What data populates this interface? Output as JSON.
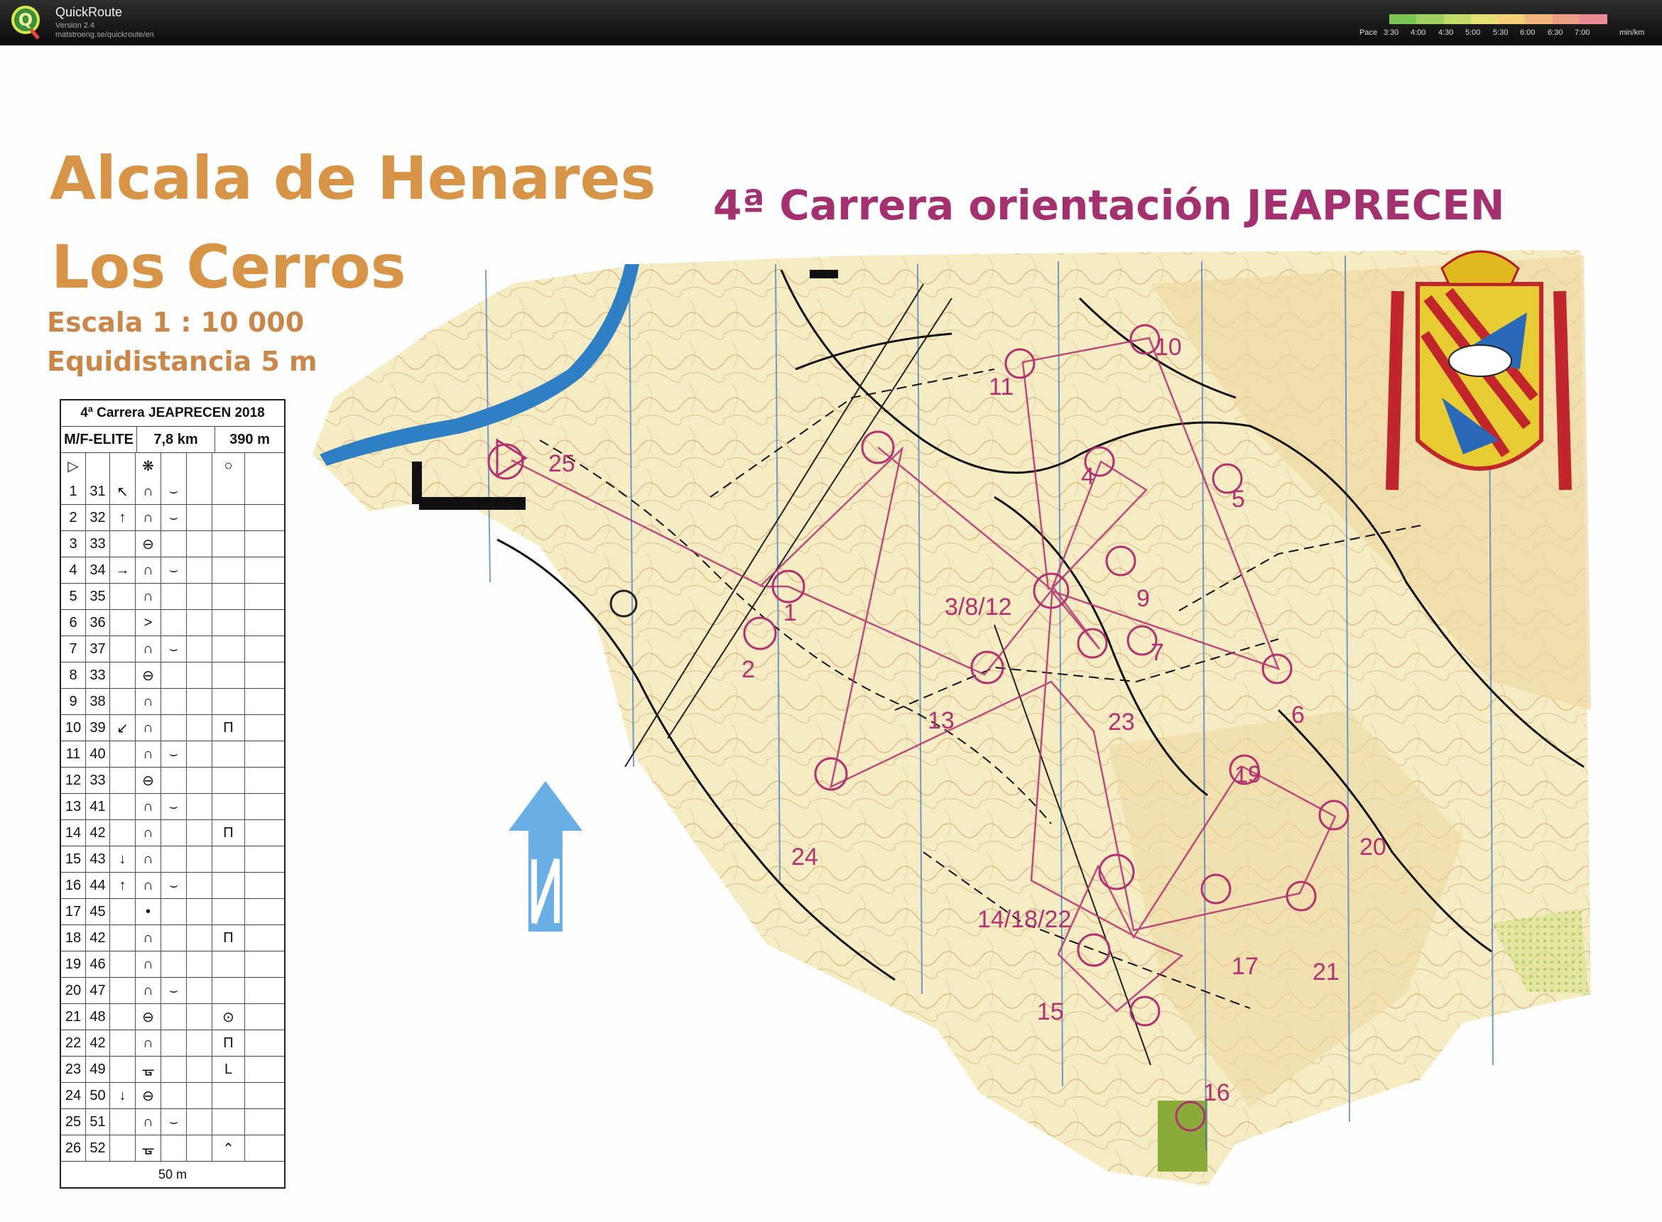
{
  "app": {
    "name": "QuickRoute",
    "version": "Version 2.4",
    "url": "matstroeng.se/quickroute/en"
  },
  "pace_legend": {
    "label": "Pace",
    "ticks": [
      "3:30",
      "4:00",
      "4:30",
      "5:00",
      "5:30",
      "6:00",
      "6:30",
      "7:00"
    ],
    "unit": "min/km",
    "colors": [
      "#7cc454",
      "#9fd061",
      "#c4da6b",
      "#e4e074",
      "#f3cf77",
      "#f2b57c",
      "#ef9d86",
      "#ea8a92"
    ]
  },
  "map": {
    "title_line1": "Alcala de Henares",
    "title_line2": "Los Cerros",
    "scale": "Escala   1 : 10 000",
    "equidistance": "Equidistancia 5 m",
    "event_title": "4ª Carrera orientación JEAPRECEN",
    "colors": {
      "course": "#b2316f",
      "paper": "#f7eec2",
      "water": "#2f7fc4",
      "north_arrow": "#6aaee6"
    }
  },
  "legend": {
    "header": "4ª Carrera JEAPRECEN 2018",
    "category": "M/F-ELITE",
    "length": "7,8 km",
    "climb": "390 m",
    "controls": [
      {
        "n": "1",
        "code": "31",
        "dir": "↖",
        "feat": "∩",
        "det": "⌣",
        "extra": ""
      },
      {
        "n": "2",
        "code": "32",
        "dir": "↑",
        "feat": "∩",
        "det": "⌣",
        "extra": ""
      },
      {
        "n": "3",
        "code": "33",
        "dir": "",
        "feat": "⊖",
        "det": "",
        "extra": ""
      },
      {
        "n": "4",
        "code": "34",
        "dir": "→",
        "feat": "∩",
        "det": "⌣",
        "extra": ""
      },
      {
        "n": "5",
        "code": "35",
        "dir": "",
        "feat": "∩",
        "det": "",
        "extra": ""
      },
      {
        "n": "6",
        "code": "36",
        "dir": "",
        "feat": ">",
        "det": "",
        "extra": ""
      },
      {
        "n": "7",
        "code": "37",
        "dir": "",
        "feat": "∩",
        "det": "⌣",
        "extra": ""
      },
      {
        "n": "8",
        "code": "33",
        "dir": "",
        "feat": "⊖",
        "det": "",
        "extra": ""
      },
      {
        "n": "9",
        "code": "38",
        "dir": "",
        "feat": "∩",
        "det": "",
        "extra": ""
      },
      {
        "n": "10",
        "code": "39",
        "dir": "↙",
        "feat": "∩",
        "det": "",
        "extra": "Π"
      },
      {
        "n": "11",
        "code": "40",
        "dir": "",
        "feat": "∩",
        "det": "⌣",
        "extra": ""
      },
      {
        "n": "12",
        "code": "33",
        "dir": "",
        "feat": "⊖",
        "det": "",
        "extra": ""
      },
      {
        "n": "13",
        "code": "41",
        "dir": "",
        "feat": "∩",
        "det": "⌣",
        "extra": ""
      },
      {
        "n": "14",
        "code": "42",
        "dir": "",
        "feat": "∩",
        "det": "",
        "extra": "Π"
      },
      {
        "n": "15",
        "code": "43",
        "dir": "↓",
        "feat": "∩",
        "det": "",
        "extra": ""
      },
      {
        "n": "16",
        "code": "44",
        "dir": "↑",
        "feat": "∩",
        "det": "⌣",
        "extra": ""
      },
      {
        "n": "17",
        "code": "45",
        "dir": "",
        "feat": "•",
        "det": "",
        "extra": ""
      },
      {
        "n": "18",
        "code": "42",
        "dir": "",
        "feat": "∩",
        "det": "",
        "extra": "Π"
      },
      {
        "n": "19",
        "code": "46",
        "dir": "",
        "feat": "∩",
        "det": "",
        "extra": ""
      },
      {
        "n": "20",
        "code": "47",
        "dir": "",
        "feat": "∩",
        "det": "⌣",
        "extra": ""
      },
      {
        "n": "21",
        "code": "48",
        "dir": "",
        "feat": "⊖",
        "det": "",
        "extra": "⊙"
      },
      {
        "n": "22",
        "code": "42",
        "dir": "",
        "feat": "∩",
        "det": "",
        "extra": "Π"
      },
      {
        "n": "23",
        "code": "49",
        "dir": "",
        "feat": "ᚗ",
        "det": "",
        "extra": "L"
      },
      {
        "n": "24",
        "code": "50",
        "dir": "↓",
        "feat": "⊖",
        "det": "",
        "extra": ""
      },
      {
        "n": "25",
        "code": "51",
        "dir": "",
        "feat": "∩",
        "det": "⌣",
        "extra": ""
      },
      {
        "n": "26",
        "code": "52",
        "dir": "",
        "feat": "ᚗ",
        "det": "",
        "extra": "⌃"
      }
    ],
    "footer": "50 m"
  },
  "control_labels": [
    {
      "id": "c1",
      "text": "1"
    },
    {
      "id": "c2",
      "text": "2"
    },
    {
      "id": "c3812",
      "text": "3/8/12"
    },
    {
      "id": "c4",
      "text": "4"
    },
    {
      "id": "c5",
      "text": "5"
    },
    {
      "id": "c6",
      "text": "6"
    },
    {
      "id": "c7",
      "text": "7"
    },
    {
      "id": "c9",
      "text": "9"
    },
    {
      "id": "c10",
      "text": "10"
    },
    {
      "id": "c11",
      "text": "11"
    },
    {
      "id": "c13",
      "text": "13"
    },
    {
      "id": "c141822",
      "text": "14/18/22"
    },
    {
      "id": "c15",
      "text": "15"
    },
    {
      "id": "c16",
      "text": "16"
    },
    {
      "id": "c17",
      "text": "17"
    },
    {
      "id": "c19",
      "text": "19"
    },
    {
      "id": "c20",
      "text": "20"
    },
    {
      "id": "c21",
      "text": "21"
    },
    {
      "id": "c23",
      "text": "23"
    },
    {
      "id": "c24",
      "text": "24"
    },
    {
      "id": "c25",
      "text": "25"
    }
  ]
}
